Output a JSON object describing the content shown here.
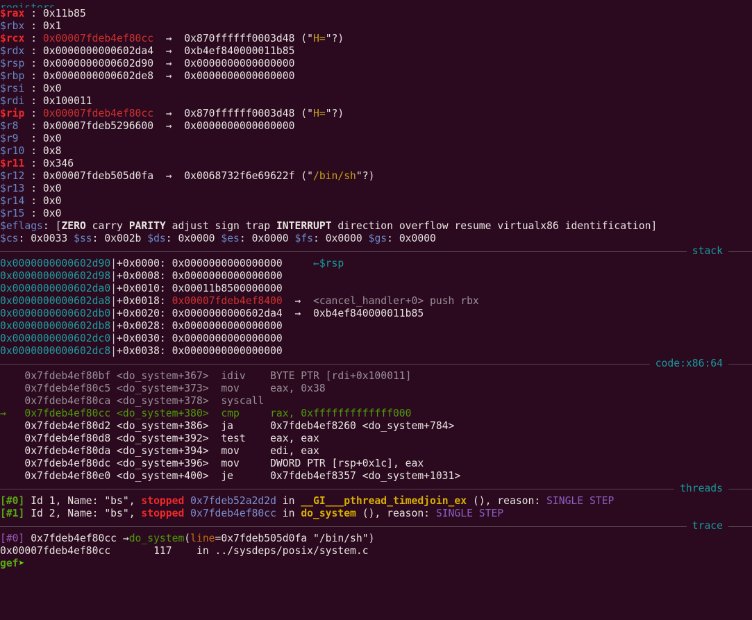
{
  "terminal": {
    "app": "gef-gdb",
    "background_color": "#2b0a20",
    "foreground_color": "#e8e4e0"
  },
  "sections": {
    "registers_label": "registers",
    "stack_label": "stack",
    "code_label": "code:x86:64",
    "threads_label": "threads",
    "trace_label": "trace"
  },
  "registers": [
    {
      "name": "$rax",
      "sep": " : ",
      "value": "0x11b85"
    },
    {
      "name": "$rbx",
      "sep": " : ",
      "value": "0x1"
    },
    {
      "name": "$rcx",
      "sep": " : ",
      "value": "0x00007fdeb4ef80cc",
      "arrow": "→",
      "deref": "0x870ffffff0003d48",
      "str_open": " (\"",
      "str": "H=",
      "str_close": "\"?)"
    },
    {
      "name": "$rdx",
      "sep": " : ",
      "value": "0x0000000000602da4",
      "arrow": "→",
      "deref": "0xb4ef840000011b85"
    },
    {
      "name": "$rsp",
      "sep": " : ",
      "value": "0x0000000000602d90",
      "arrow": "→",
      "deref": "0x0000000000000000"
    },
    {
      "name": "$rbp",
      "sep": " : ",
      "value": "0x0000000000602de8",
      "arrow": "→",
      "deref": "0x0000000000000000"
    },
    {
      "name": "$rsi",
      "sep": " : ",
      "value": "0x0"
    },
    {
      "name": "$rdi",
      "sep": " : ",
      "value": "0x100011"
    },
    {
      "name": "$rip",
      "sep": " : ",
      "value": "0x00007fdeb4ef80cc",
      "arrow": "→",
      "deref": "0x870ffffff0003d48",
      "str_open": " (\"",
      "str": "H=",
      "str_close": "\"?)"
    },
    {
      "name": "$r8",
      "sep": "  : ",
      "value": "0x00007fdeb5296600",
      "arrow": "→",
      "deref": "0x0000000000000000"
    },
    {
      "name": "$r9",
      "sep": "  : ",
      "value": "0x0"
    },
    {
      "name": "$r10",
      "sep": " : ",
      "value": "0x8"
    },
    {
      "name": "$r11",
      "sep": " : ",
      "value": "0x346"
    },
    {
      "name": "$r12",
      "sep": " : ",
      "value": "0x00007fdeb505d0fa",
      "arrow": "→",
      "deref": "0x0068732f6e69622f",
      "str_open": " (\"",
      "str": "/bin/sh",
      "str_close": "\"?)"
    },
    {
      "name": "$r13",
      "sep": " : ",
      "value": "0x0"
    },
    {
      "name": "$r14",
      "sep": " : ",
      "value": "0x0"
    },
    {
      "name": "$r15",
      "sep": " : ",
      "value": "0x0"
    }
  ],
  "register_highlight": [
    "$rax",
    "$rcx",
    "$rip",
    "$r11"
  ],
  "eflags": {
    "label": "$eflags",
    "sep": ": ",
    "open": "[",
    "close": "]",
    "flags": [
      {
        "name": "ZERO",
        "set": true
      },
      {
        "name": "carry",
        "set": false
      },
      {
        "name": "PARITY",
        "set": true
      },
      {
        "name": "adjust",
        "set": false
      },
      {
        "name": "sign",
        "set": false
      },
      {
        "name": "trap",
        "set": false
      },
      {
        "name": "INTERRUPT",
        "set": true
      },
      {
        "name": "direction",
        "set": false
      },
      {
        "name": "overflow",
        "set": false
      },
      {
        "name": "resume",
        "set": false
      },
      {
        "name": "virtualx86",
        "set": false
      },
      {
        "name": "identification",
        "set": false
      }
    ]
  },
  "segments": [
    {
      "name": "$cs",
      "value": "0x0033"
    },
    {
      "name": "$ss",
      "value": "0x002b"
    },
    {
      "name": "$ds",
      "value": "0x0000"
    },
    {
      "name": "$es",
      "value": "0x0000"
    },
    {
      "name": "$fs",
      "value": "0x0000"
    },
    {
      "name": "$gs",
      "value": "0x0000"
    }
  ],
  "stack": [
    {
      "addr": "0x0000000000602d90",
      "offset": "+0x0000: ",
      "value": "0x0000000000000000",
      "marker": "←$rsp"
    },
    {
      "addr": "0x0000000000602d98",
      "offset": "+0x0008: ",
      "value": "0x0000000000000000"
    },
    {
      "addr": "0x0000000000602da0",
      "offset": "+0x0010: ",
      "value": "0x00011b8500000000"
    },
    {
      "addr": "0x0000000000602da8",
      "offset": "+0x0018: ",
      "value": "0x00007fdeb4ef8400",
      "value_red": true,
      "arrow": "→",
      "symbol": "<cancel_handler+0> push rbx"
    },
    {
      "addr": "0x0000000000602db0",
      "offset": "+0x0020: ",
      "value": "0x0000000000602da4",
      "arrow": "→",
      "deref": "0xb4ef840000011b85"
    },
    {
      "addr": "0x0000000000602db8",
      "offset": "+0x0028: ",
      "value": "0x0000000000000000"
    },
    {
      "addr": "0x0000000000602dc0",
      "offset": "+0x0030: ",
      "value": "0x0000000000000000"
    },
    {
      "addr": "0x0000000000602dc8",
      "offset": "+0x0038: ",
      "value": "0x0000000000000000"
    }
  ],
  "code": [
    {
      "cursor": "  ",
      "addr": "0x7fdeb4ef80bf",
      "sym": "<do_system+367>",
      "mnemonic": "idiv",
      "operands": "BYTE PTR [rdi+0x100011]",
      "state": "past"
    },
    {
      "cursor": "  ",
      "addr": "0x7fdeb4ef80c5",
      "sym": "<do_system+373>",
      "mnemonic": "mov ",
      "operands": "eax, 0x38",
      "state": "past"
    },
    {
      "cursor": "  ",
      "addr": "0x7fdeb4ef80ca",
      "sym": "<do_system+378>",
      "mnemonic": "syscall",
      "operands": "",
      "state": "past"
    },
    {
      "cursor": "→ ",
      "addr": "0x7fdeb4ef80cc",
      "sym": "<do_system+380>",
      "mnemonic": "cmp ",
      "operands": "rax, 0xfffffffffffff000",
      "state": "current"
    },
    {
      "cursor": "  ",
      "addr": "0x7fdeb4ef80d2",
      "sym": "<do_system+386>",
      "mnemonic": "ja  ",
      "operands": "0x7fdeb4ef8260 <do_system+784>",
      "state": "next"
    },
    {
      "cursor": "  ",
      "addr": "0x7fdeb4ef80d8",
      "sym": "<do_system+392>",
      "mnemonic": "test",
      "operands": "eax, eax",
      "state": "next"
    },
    {
      "cursor": "  ",
      "addr": "0x7fdeb4ef80da",
      "sym": "<do_system+394>",
      "mnemonic": "mov ",
      "operands": "edi, eax",
      "state": "next"
    },
    {
      "cursor": "  ",
      "addr": "0x7fdeb4ef80dc",
      "sym": "<do_system+396>",
      "mnemonic": "mov ",
      "operands": "DWORD PTR [rsp+0x1c], eax",
      "state": "next"
    },
    {
      "cursor": "  ",
      "addr": "0x7fdeb4ef80e0",
      "sym": "<do_system+400>",
      "mnemonic": "je  ",
      "operands": "0x7fdeb4ef8357 <do_system+1031>",
      "state": "next"
    }
  ],
  "threads": [
    {
      "index": "[#0]",
      "id_text": " Id 1, Name: \"bs\", ",
      "status": "stopped",
      "addr": " 0x7fdeb52a2d2d",
      "in_text": " in ",
      "func": "__GI___pthread_timedjoin_ex",
      "args": " (), reason: ",
      "reason": "SINGLE STEP"
    },
    {
      "index": "[#1]",
      "id_text": " Id 2, Name: \"bs\", ",
      "status": "stopped",
      "addr": " 0x7fdeb4ef80cc",
      "in_text": " in ",
      "func": "do_system",
      "args": " (), reason: ",
      "reason": "SINGLE STEP"
    }
  ],
  "trace": [
    {
      "index": "[#0]",
      "addr": " 0x7fdeb4ef80cc ",
      "arrow": "→",
      "func": "do_system",
      "paren_open": "(",
      "arg_name": "line",
      "eq": "=",
      "arg_value": "0x7fdeb505d0fa \"/bin/sh\"",
      "paren_close": ")"
    }
  ],
  "source_line": {
    "addr": "0x00007fdeb4ef80cc",
    "gap1": "       ",
    "lineno": "117",
    "gap2": "    ",
    "text": "in ../sysdeps/posix/system.c"
  },
  "prompt": {
    "text": "gef",
    "arrow": "➤",
    "input": ""
  },
  "colors": {
    "accent_red": "#ef2929",
    "accent_teal": "#169a9a",
    "accent_green": "#57a813",
    "accent_blue": "#6a86c4",
    "accent_yellow": "#d7af00",
    "accent_purple": "#9b59b6",
    "background": "#2b0a20"
  }
}
